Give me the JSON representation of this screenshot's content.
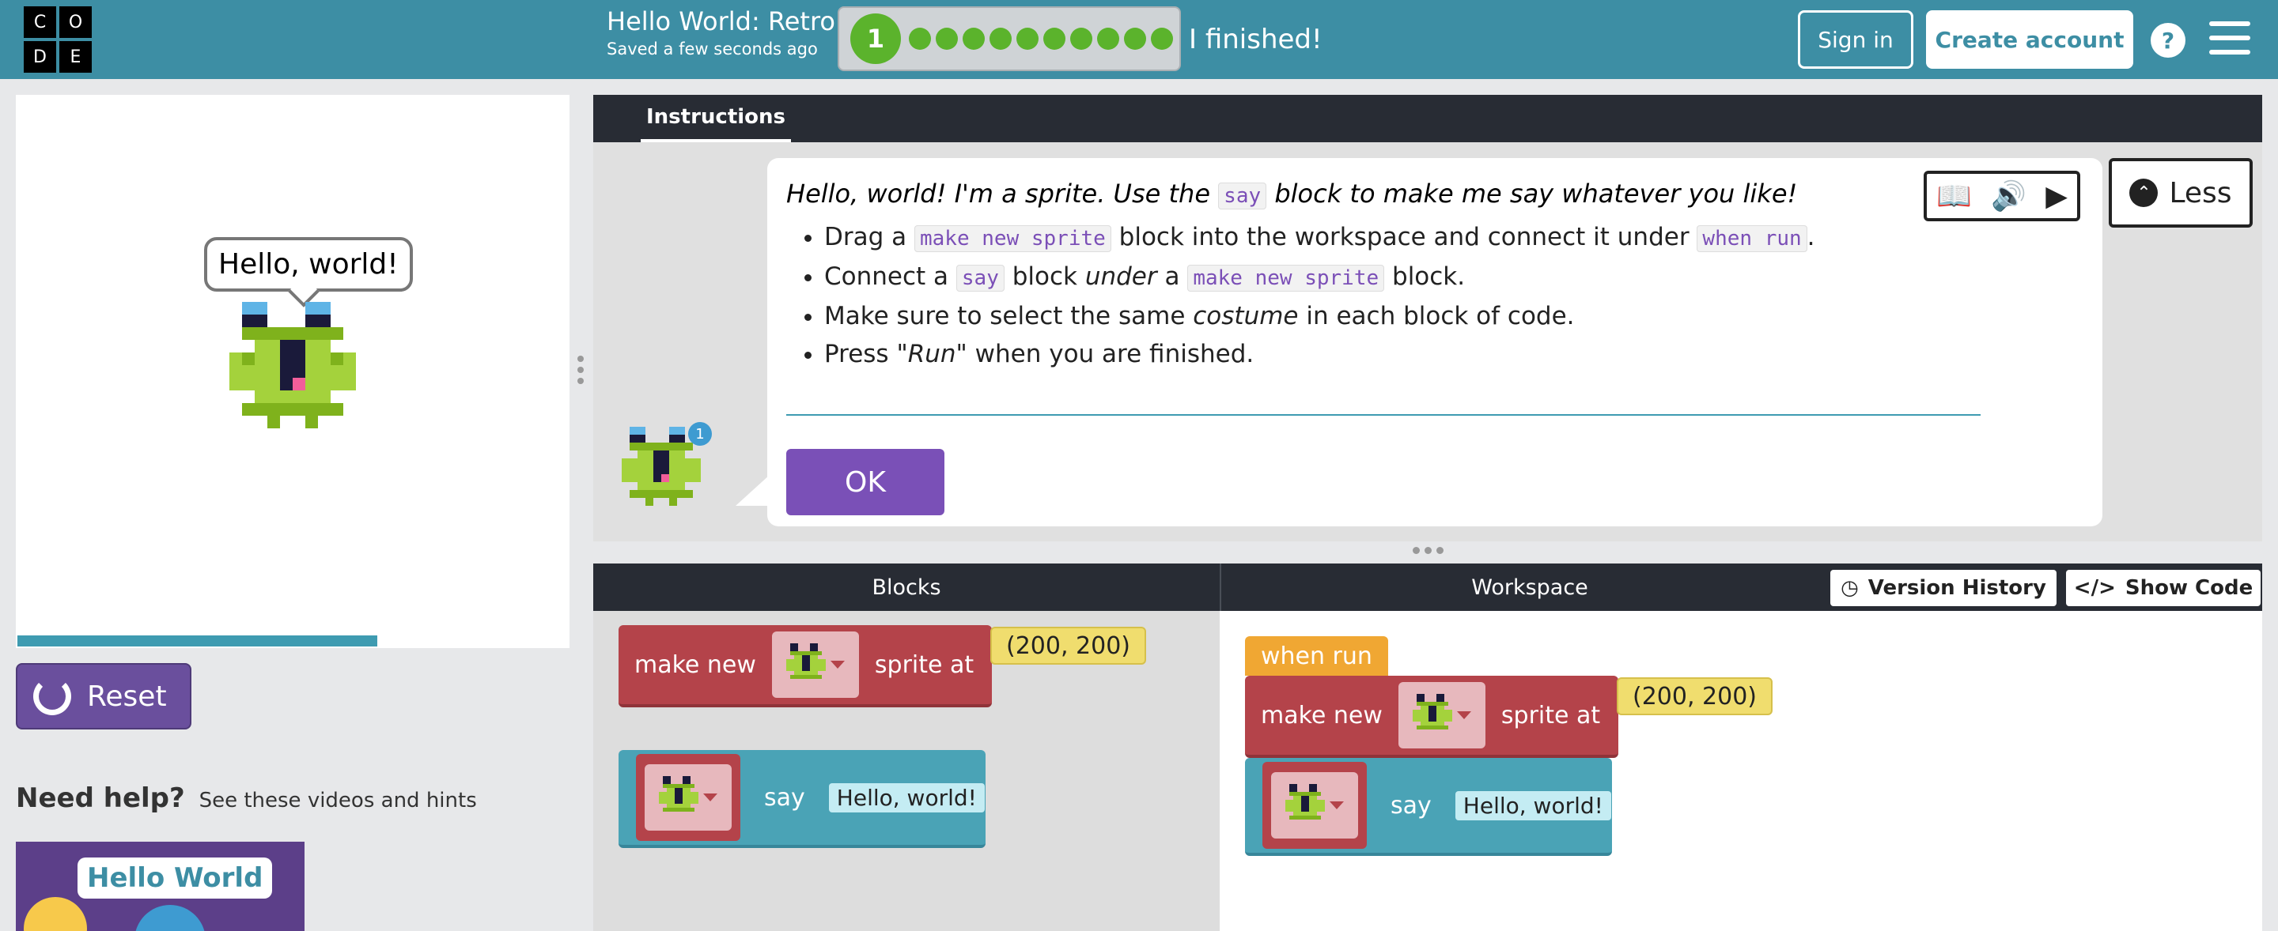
{
  "header": {
    "logo_letters": [
      "C",
      "O",
      "D",
      "E"
    ],
    "level_title": "Hello World: Retro",
    "saved_status": "Saved a few seconds ago",
    "current_level": "1",
    "finished_label": "I finished!",
    "sign_in": "Sign in",
    "create_account": "Create account",
    "help": "?",
    "colors": {
      "bar": "#3d8ea4",
      "progress_dot": "#5bb32c"
    }
  },
  "stage": {
    "speech_text": "Hello, world!",
    "progress_fraction": 0.65
  },
  "left": {
    "reset_label": "Reset",
    "need_help": "Need help?",
    "need_help_sub": "See these videos and hints",
    "video_label": "Hello World"
  },
  "instructions": {
    "tab": "Instructions",
    "intro_pre": "Hello, world! I'm a sprite. Use the ",
    "intro_code": "say",
    "intro_post": " block to make me say whatever you like!",
    "bullets": {
      "b1_pre": "Drag a ",
      "b1_code1": "make new sprite",
      "b1_mid": " block into the workspace and connect it under ",
      "b1_code2": "when run",
      "b1_post": ".",
      "b2_pre": "Connect a ",
      "b2_code1": "say",
      "b2_mid1": " block ",
      "b2_em": "under",
      "b2_mid2": " a ",
      "b2_code2": "make new sprite",
      "b2_post": " block.",
      "b3_pre": "Make sure to select the same ",
      "b3_em": "costume",
      "b3_post": " in each block of code.",
      "b4_pre": "Press ",
      "b4_em": "\"Run\"",
      "b4_post": " when you are finished."
    },
    "ok": "OK",
    "less": "Less",
    "hint_count": "1"
  },
  "workspace": {
    "blocks_title": "Blocks",
    "workspace_title": "Workspace",
    "version_history": "Version History",
    "show_code": "Show Code",
    "make_new": "make new",
    "sprite_at": "sprite at",
    "coords": "(200, 200)",
    "say": "say",
    "say_text": "Hello, world!",
    "when_run": "when run"
  }
}
